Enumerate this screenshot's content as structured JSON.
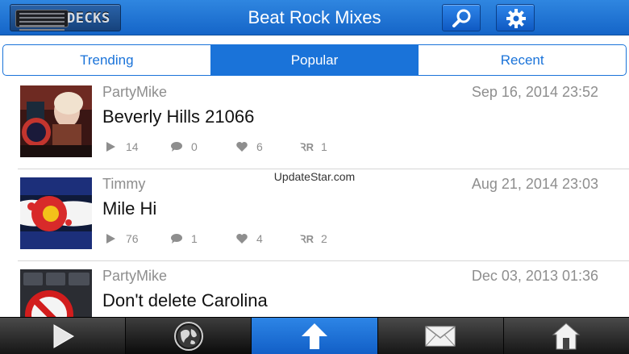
{
  "header": {
    "decks_label": "DECKS",
    "title": "Beat Rock Mixes",
    "search_icon": "search-icon",
    "settings_icon": "gear-icon"
  },
  "tabs": [
    {
      "label": "Trending",
      "active": false
    },
    {
      "label": "Popular",
      "active": true
    },
    {
      "label": "Recent",
      "active": false
    }
  ],
  "mixes": [
    {
      "user": "PartyMike",
      "date": "Sep 16, 2014 23:52",
      "title": "Beverly Hills 21066",
      "plays": "14",
      "comments": "0",
      "likes": "6",
      "remixes": "1"
    },
    {
      "user": "Timmy",
      "date": "Aug 21, 2014 23:03",
      "title": "Mile Hi",
      "plays": "76",
      "comments": "1",
      "likes": "4",
      "remixes": "2"
    },
    {
      "user": "PartyMike",
      "date": "Dec 03, 2013 01:36",
      "title": "Don't delete Carolina",
      "plays": "",
      "comments": "",
      "likes": "",
      "remixes": ""
    }
  ],
  "watermark": "UpdateStar.com",
  "bottom_bar": {
    "items": [
      "play-icon",
      "globe-icon",
      "upload-arrow-icon",
      "mail-icon",
      "home-icon"
    ],
    "active_index": 2
  },
  "colors": {
    "accent": "#1a73d9",
    "header": "#1f72d6"
  }
}
